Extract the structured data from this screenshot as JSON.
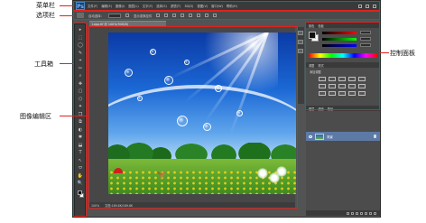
{
  "annotations": {
    "menu_bar": "菜单栏",
    "options_bar": "选项栏",
    "toolbox": "工具箱",
    "image_editing_area": "图像编辑区",
    "control_panel": "控制面板"
  },
  "app": {
    "logo": "Ps",
    "menu": [
      "文件(F)",
      "编辑(E)",
      "图像(I)",
      "图层(L)",
      "文字(Y)",
      "选择(S)",
      "滤镜(T)",
      "3D(D)",
      "视图(V)",
      "窗口(W)",
      "帮助(H)"
    ]
  },
  "options": {
    "auto_select": "自动选择：",
    "layer_select": "图层",
    "show_transform": "显示变换控件"
  },
  "tools": [
    "▸",
    "⬚",
    "◯",
    "✎",
    "⌖",
    "✂",
    "⌕",
    "✚",
    "▢",
    "⬡",
    "✦",
    "❒",
    "⧉",
    "◐",
    "✱",
    "⬓",
    "T",
    "↖",
    "⬭",
    "✋",
    "🔍"
  ],
  "document": {
    "tab": "Lapp.tif @ 100%(RGB/8)",
    "zoom": "100%",
    "status": "文档:189.8K/189.8K"
  },
  "panels": {
    "color_tabs": [
      "颜色",
      "色板"
    ],
    "adjust_tabs": [
      "调整",
      "样式"
    ],
    "adjust_title": "添加调整",
    "layers_tabs": [
      "图层",
      "通道",
      "路径"
    ],
    "layer_name": "背景"
  },
  "colors": {
    "annotation_red": "#e0221d",
    "app_background": "#535353",
    "layer_selected": "#5d7aa6"
  }
}
